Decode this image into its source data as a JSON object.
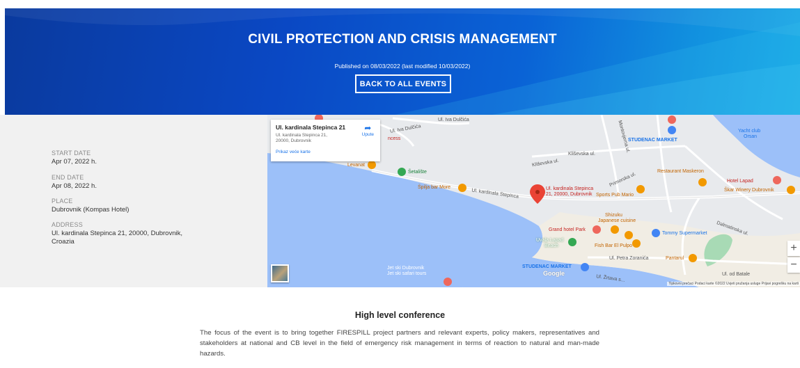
{
  "hero": {
    "title": "CIVIL PROTECTION AND CRISIS MANAGEMENT",
    "published": "Published on 08/03/2022 (last modified 10/03/2022)",
    "back_button": "BACK TO ALL EVENTS"
  },
  "details": {
    "start_label": "START DATE",
    "start_value": "Apr 07, 2022 h.",
    "end_label": "END DATE",
    "end_value": "Apr 08, 2022 h.",
    "place_label": "PLACE",
    "place_value": "Dubrovnik (Kompas Hotel)",
    "address_label": "ADDRESS",
    "address_line1": "Ul. kardinala Stepinca 21, 20000, Dubrovnik,",
    "address_line2": "Croazia"
  },
  "map": {
    "card_title": "Ul. kardinala Stepinca 21",
    "card_address": "Ul. kardinala Stepinca 21, 20000, Dubrovnik",
    "card_directions": "Upute",
    "card_link": "Prikaz veće karte",
    "zoom_in": "+",
    "zoom_out": "−",
    "marker_label_1": "Ul. kardinala Stepinca",
    "marker_label_2": "21, 20000, Dubrovnik",
    "attribution": "Tipkovni prečaci   Podaci karte ©2022   Uvjeti pružanja usluge   Prijavi pogrešku na karti",
    "google": "Google",
    "labels": {
      "iva_dulcica": "Ul. Iva Dulčića",
      "iva_dulcica2": "Ul. Iva Dulčića",
      "kliseva1": "Kliševska ul.",
      "kliseva2": "Kliševska ul.",
      "montovjerna": "Montovjerna ul.",
      "primorska": "Primorska ul.",
      "dalmatinska": "Dalmatinska ul.",
      "stepinca_road": "Ul. kardinala Stepinca",
      "petra_zoranica": "Ul. Petra Zoranića",
      "od_batale": "Ul. od Batale",
      "zrtava": "Ul. Žrtava s..."
    },
    "pois": {
      "studenac1": "STUDENAC MARKET",
      "studenac2": "STUDENAC MARKET",
      "yacht": "Yacht club",
      "orsan": "Orsan",
      "maskeron": "Restaurant Maskeron",
      "hotel_lapad": "Hotel Lapad",
      "skar": "Škar Winery Dubrovnik",
      "setaliste": "Šetalište",
      "spilja": "Špilja bar More",
      "sports_pub": "Sports Pub Mario",
      "shizuku1": "Shizuku",
      "shizuku2": "Japanese cuisine",
      "grand_hotel": "Grand hotel Park",
      "tommy": "Tommy Supermarket",
      "uvala1": "Uvala Lapad",
      "uvala2": "Beach",
      "fish_bar": "Fish Bar El Pulpo",
      "pantarul": "Pantarul",
      "jetski1": "Jet ski Dubrovnik",
      "jetski2": "Jet ski safari tours",
      "levanat": "Levanat",
      "princess": "ncess"
    }
  },
  "content": {
    "title": "High level conference",
    "text": "The focus of the event is to bring together FIRESPILL project partners and relevant experts, policy makers, representatives and stakeholders at national and CB level in the field of emergency risk management in terms of reaction to natural and man-made hazards."
  }
}
